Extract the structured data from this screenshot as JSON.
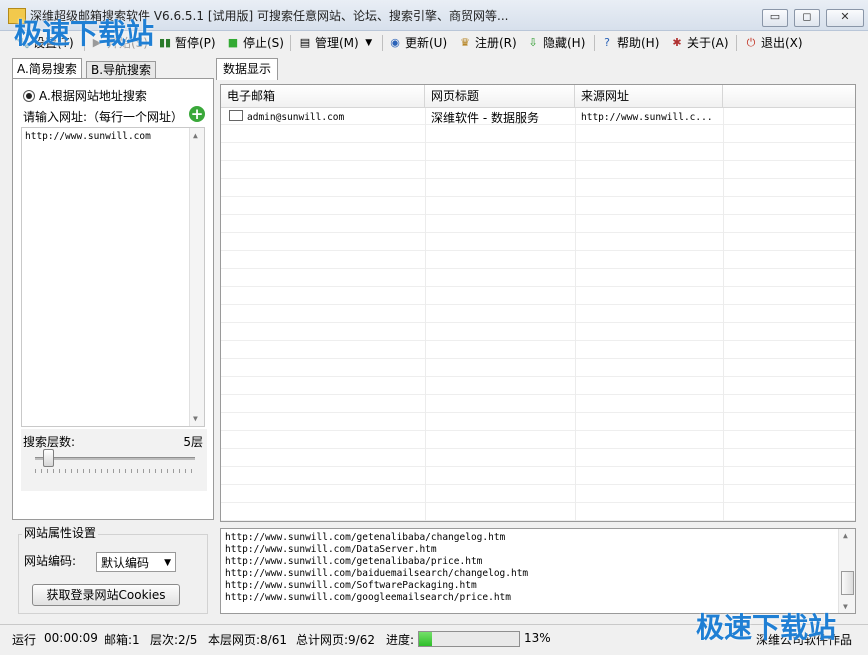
{
  "window": {
    "title": "深维超级邮箱搜索软件 V6.6.5.1 [试用版] 可搜索任意网站、论坛、搜索引擎、商贸网等...",
    "min_label": "▭",
    "max_label": "◻",
    "close_label": "✕"
  },
  "toolbar": {
    "settings": "设置(T)",
    "start": "开始(S)",
    "pause": "暂停(P)",
    "stop": "停止(S)",
    "manage": "管理(M)",
    "update": "更新(U)",
    "register": "注册(R)",
    "hide": "隐藏(H)",
    "help": "帮助(H)",
    "about": "关于(A)",
    "exit": "退出(X)"
  },
  "left_tabs": [
    "A.简易搜索",
    "B.导航搜索"
  ],
  "search": {
    "radio_label": "A.根据网站地址搜索",
    "url_label": "请输入网址:（每行一个网址）",
    "url_value": "http://www.sunwill.com",
    "depth_label": "搜索层数:",
    "depth_value": "5层"
  },
  "site_props": {
    "title": "网站属性设置",
    "encoding_label": "网站编码:",
    "encoding_value": "默认编码",
    "cookie_button": "获取登录网站Cookies"
  },
  "data_tab": "数据显示",
  "table": {
    "columns": [
      "电子邮箱",
      "网页标题",
      "来源网址"
    ],
    "rows": [
      [
        "admin@sunwill.com",
        "深维软件 - 数据服务",
        "http://www.sunwill.c..."
      ]
    ]
  },
  "log": [
    "http://www.sunwill.com/getenalibaba/changelog.htm",
    "http://www.sunwill.com/DataServer.htm",
    "http://www.sunwill.com/getenalibaba/price.htm",
    "http://www.sunwill.com/baiduemailsearch/changelog.htm",
    "http://www.sunwill.com/SoftwarePackaging.htm",
    "http://www.sunwill.com/googleemailsearch/price.htm"
  ],
  "status": {
    "run": "运行",
    "time": "00:00:09",
    "mailbox": "邮箱:1",
    "level": "层次:2/5",
    "page": "本层网页:8/61",
    "total": "总计网页:9/62",
    "progress_label": "进度:",
    "progress_pct": "13%",
    "progress_fraction": 0.13,
    "company": "深维公司软件作品"
  },
  "watermark": {
    "top": "极速下载站",
    "bottom": "极速下载站"
  },
  "colors": {
    "progress_green": "#2fbe2a",
    "watermark_blue": "#1f7fd4"
  }
}
